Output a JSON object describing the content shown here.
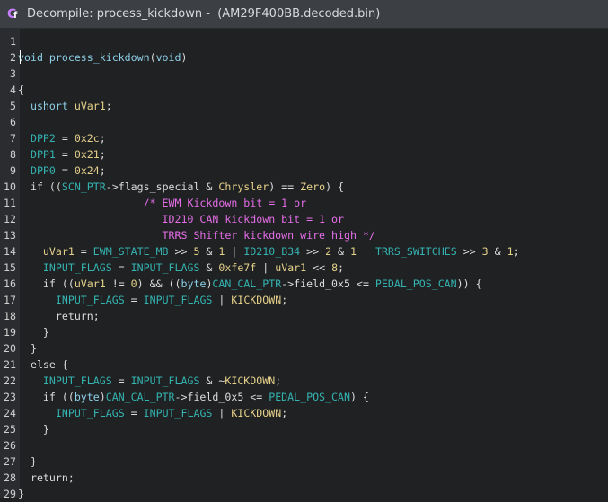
{
  "window": {
    "title": "Decompile: process_kickdown -  (AM29F400BB.decoded.bin)",
    "icon": "decompiler-icon"
  },
  "colors": {
    "type": "#8fd0e8",
    "function": "#8fd0e8",
    "variable": "#e6d18a",
    "global": "#34b3b0",
    "number": "#e6d18a",
    "comment": "#e66ee8",
    "text": "#dcdcdc"
  },
  "code": {
    "lines": [
      {
        "n": "1",
        "tokens": []
      },
      {
        "n": "2",
        "tokens": [
          [
            "type",
            "void"
          ],
          [
            "txt",
            " "
          ],
          [
            "fn",
            "process_kickdown"
          ],
          [
            "txt",
            "("
          ],
          [
            "type",
            "void"
          ],
          [
            "txt",
            ")"
          ]
        ]
      },
      {
        "n": "3",
        "tokens": []
      },
      {
        "n": "4",
        "tokens": [
          [
            "txt",
            "{"
          ]
        ]
      },
      {
        "n": "5",
        "tokens": [
          [
            "txt",
            "  "
          ],
          [
            "type",
            "ushort"
          ],
          [
            "txt",
            " "
          ],
          [
            "var",
            "uVar1"
          ],
          [
            "txt",
            ";"
          ]
        ]
      },
      {
        "n": "6",
        "tokens": []
      },
      {
        "n": "7",
        "tokens": [
          [
            "txt",
            "  "
          ],
          [
            "glob",
            "DPP2"
          ],
          [
            "txt",
            " = "
          ],
          [
            "num",
            "0x2c"
          ],
          [
            "txt",
            ";"
          ]
        ]
      },
      {
        "n": "8",
        "tokens": [
          [
            "txt",
            "  "
          ],
          [
            "glob",
            "DPP1"
          ],
          [
            "txt",
            " = "
          ],
          [
            "num",
            "0x21"
          ],
          [
            "txt",
            ";"
          ]
        ]
      },
      {
        "n": "9",
        "tokens": [
          [
            "txt",
            "  "
          ],
          [
            "glob",
            "DPP0"
          ],
          [
            "txt",
            " = "
          ],
          [
            "num",
            "0x24"
          ],
          [
            "txt",
            ";"
          ]
        ]
      },
      {
        "n": "10",
        "tokens": [
          [
            "txt",
            "  if (("
          ],
          [
            "glob",
            "SCN_PTR"
          ],
          [
            "txt",
            "->flags_special & "
          ],
          [
            "num",
            "Chrysler"
          ],
          [
            "txt",
            ") == "
          ],
          [
            "num",
            "Zero"
          ],
          [
            "txt",
            ") {"
          ]
        ]
      },
      {
        "n": "11",
        "tokens": [
          [
            "txt",
            "                    "
          ],
          [
            "cmt",
            "/* EWM Kickdown bit = 1 or"
          ]
        ]
      },
      {
        "n": "12",
        "tokens": [
          [
            "txt",
            "                       "
          ],
          [
            "cmt",
            "ID210 CAN kickdown bit = 1 or"
          ]
        ]
      },
      {
        "n": "13",
        "tokens": [
          [
            "txt",
            "                       "
          ],
          [
            "cmt",
            "TRRS Shifter kickdown wire high */"
          ]
        ]
      },
      {
        "n": "14",
        "tokens": [
          [
            "txt",
            "    "
          ],
          [
            "var",
            "uVar1"
          ],
          [
            "txt",
            " = "
          ],
          [
            "glob",
            "EWM_STATE_MB"
          ],
          [
            "txt",
            " >> "
          ],
          [
            "num",
            "5"
          ],
          [
            "txt",
            " & "
          ],
          [
            "num",
            "1"
          ],
          [
            "txt",
            " | "
          ],
          [
            "glob",
            "ID210_B34"
          ],
          [
            "txt",
            " >> "
          ],
          [
            "num",
            "2"
          ],
          [
            "txt",
            " & "
          ],
          [
            "num",
            "1"
          ],
          [
            "txt",
            " | "
          ],
          [
            "glob",
            "TRRS_SWITCHES"
          ],
          [
            "txt",
            " >> "
          ],
          [
            "num",
            "3"
          ],
          [
            "txt",
            " & "
          ],
          [
            "num",
            "1"
          ],
          [
            "txt",
            ";"
          ]
        ]
      },
      {
        "n": "15",
        "tokens": [
          [
            "txt",
            "    "
          ],
          [
            "glob",
            "INPUT_FLAGS"
          ],
          [
            "txt",
            " = "
          ],
          [
            "glob",
            "INPUT_FLAGS"
          ],
          [
            "txt",
            " & "
          ],
          [
            "num",
            "0xfe7f"
          ],
          [
            "txt",
            " | "
          ],
          [
            "var",
            "uVar1"
          ],
          [
            "txt",
            " << "
          ],
          [
            "num",
            "8"
          ],
          [
            "txt",
            ";"
          ]
        ]
      },
      {
        "n": "16",
        "tokens": [
          [
            "txt",
            "    if (("
          ],
          [
            "var",
            "uVar1"
          ],
          [
            "txt",
            " != "
          ],
          [
            "num",
            "0"
          ],
          [
            "txt",
            ") && (("
          ],
          [
            "type",
            "byte"
          ],
          [
            "txt",
            ")"
          ],
          [
            "glob",
            "CAN_CAL_PTR"
          ],
          [
            "txt",
            "->field_0x5 <= "
          ],
          [
            "glob",
            "PEDAL_POS_CAN"
          ],
          [
            "txt",
            ")) {"
          ]
        ]
      },
      {
        "n": "17",
        "tokens": [
          [
            "txt",
            "      "
          ],
          [
            "glob",
            "INPUT_FLAGS"
          ],
          [
            "txt",
            " = "
          ],
          [
            "glob",
            "INPUT_FLAGS"
          ],
          [
            "txt",
            " | "
          ],
          [
            "num",
            "KICKDOWN"
          ],
          [
            "txt",
            ";"
          ]
        ]
      },
      {
        "n": "18",
        "tokens": [
          [
            "txt",
            "      return;"
          ]
        ]
      },
      {
        "n": "19",
        "tokens": [
          [
            "txt",
            "    }"
          ]
        ]
      },
      {
        "n": "20",
        "tokens": [
          [
            "txt",
            "  }"
          ]
        ]
      },
      {
        "n": "21",
        "tokens": [
          [
            "txt",
            "  else {"
          ]
        ]
      },
      {
        "n": "22",
        "tokens": [
          [
            "txt",
            "    "
          ],
          [
            "glob",
            "INPUT_FLAGS"
          ],
          [
            "txt",
            " = "
          ],
          [
            "glob",
            "INPUT_FLAGS"
          ],
          [
            "txt",
            " & ~"
          ],
          [
            "num",
            "KICKDOWN"
          ],
          [
            "txt",
            ";"
          ]
        ]
      },
      {
        "n": "23",
        "tokens": [
          [
            "txt",
            "    if (("
          ],
          [
            "type",
            "byte"
          ],
          [
            "txt",
            ")"
          ],
          [
            "glob",
            "CAN_CAL_PTR"
          ],
          [
            "txt",
            "->field_0x5 <= "
          ],
          [
            "glob",
            "PEDAL_POS_CAN"
          ],
          [
            "txt",
            ") {"
          ]
        ]
      },
      {
        "n": "24",
        "tokens": [
          [
            "txt",
            "      "
          ],
          [
            "glob",
            "INPUT_FLAGS"
          ],
          [
            "txt",
            " = "
          ],
          [
            "glob",
            "INPUT_FLAGS"
          ],
          [
            "txt",
            " | "
          ],
          [
            "num",
            "KICKDOWN"
          ],
          [
            "txt",
            ";"
          ]
        ]
      },
      {
        "n": "25",
        "tokens": [
          [
            "txt",
            "    }"
          ]
        ]
      },
      {
        "n": "26",
        "tokens": []
      },
      {
        "n": "27",
        "tokens": [
          [
            "txt",
            "  }"
          ]
        ]
      },
      {
        "n": "28",
        "tokens": [
          [
            "txt",
            "  return;"
          ]
        ]
      },
      {
        "n": "29",
        "tokens": [
          [
            "txt",
            "}"
          ]
        ]
      }
    ]
  }
}
